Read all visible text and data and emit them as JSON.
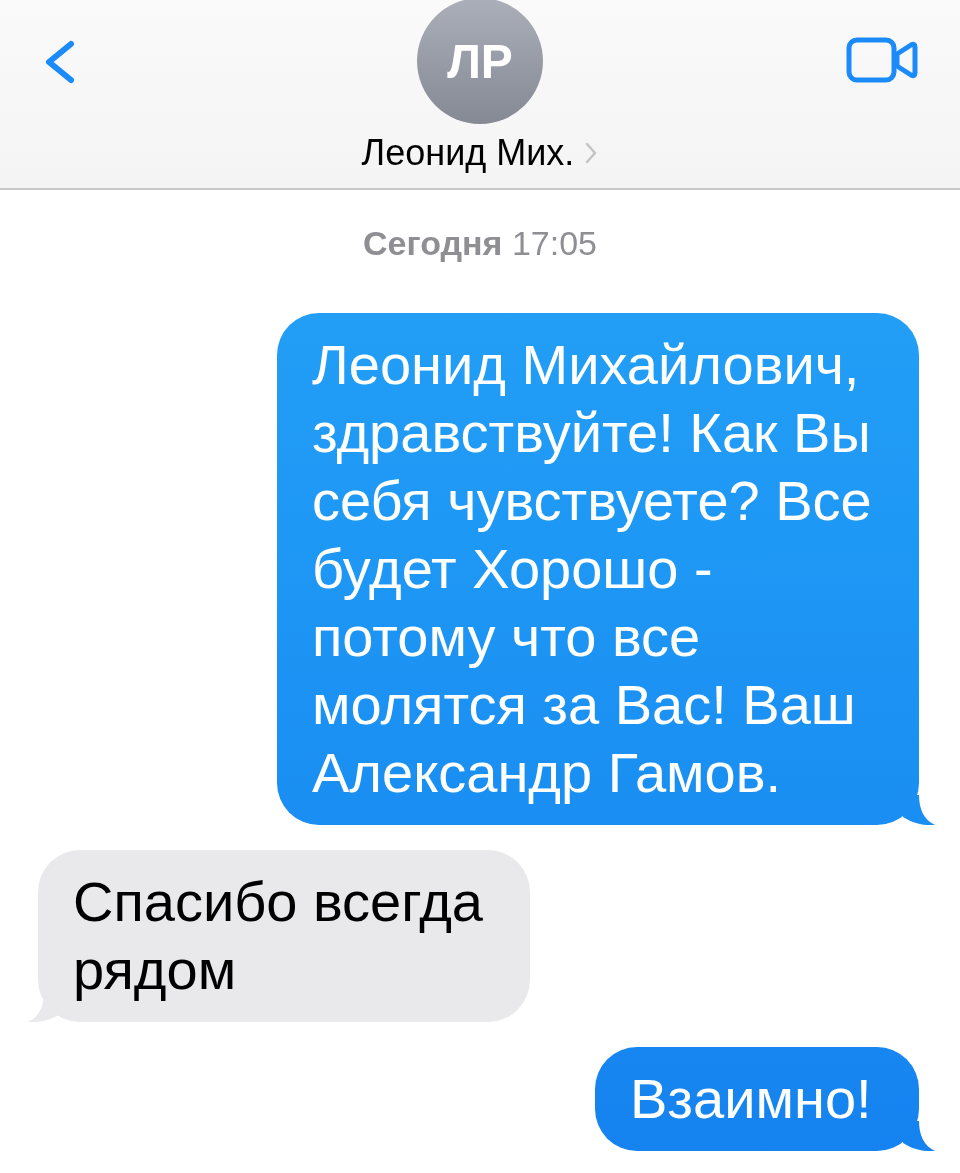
{
  "header": {
    "avatar": {
      "initials": "ЛР"
    },
    "contact_name": "Леонид Мих."
  },
  "timestamp": "**Сегодня** 17:05",
  "messages": [
    {
      "kind": "sent",
      "text": "Леонид Михайлович, здравствуйте! Как Вы себя чувствуете? Все будет Хорошо - потому что все молятся за Вас! Ваш Александр Гамов."
    },
    {
      "kind": "received",
      "text": "Спасибо всегда рядом"
    },
    {
      "kind": "sent",
      "text": "Взаимно!"
    }
  ]
}
